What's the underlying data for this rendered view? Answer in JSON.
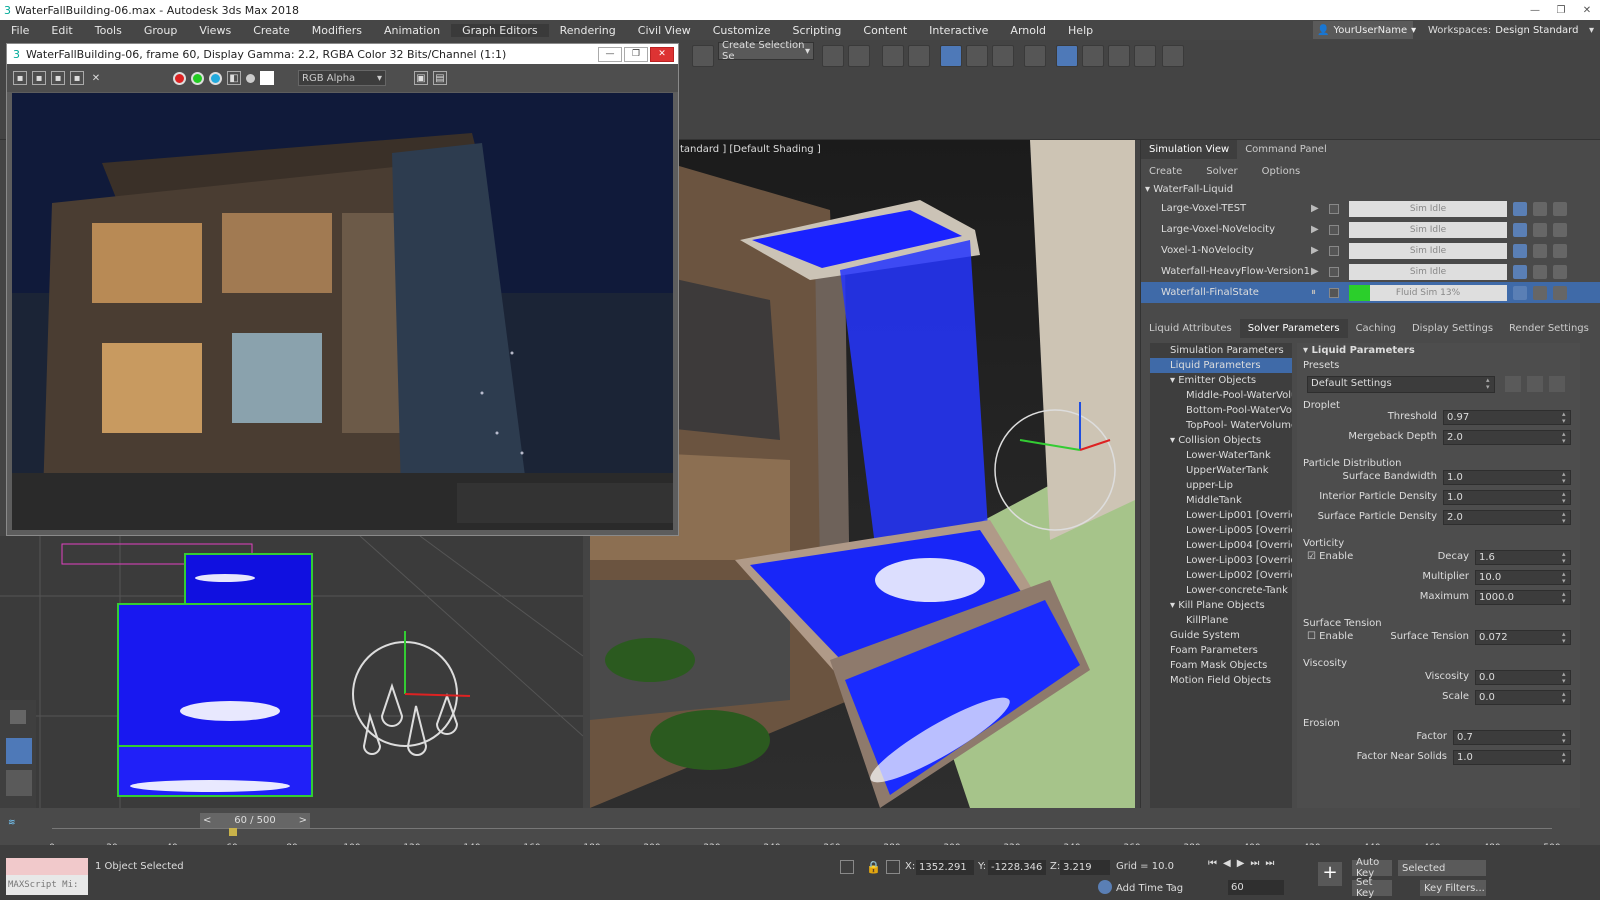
{
  "app": {
    "window_title": "WaterFallBuilding-06.max - Autodesk 3ds Max 2018",
    "user_name": "YourUserName",
    "workspaces_label": "Workspaces:",
    "workspace_value": "Design Standard"
  },
  "menu": [
    "File",
    "Edit",
    "Tools",
    "Group",
    "Views",
    "Create",
    "Modifiers",
    "Animation",
    "Graph Editors",
    "Rendering",
    "Civil View",
    "Customize",
    "Scripting",
    "Content",
    "Interactive",
    "Arnold",
    "Help"
  ],
  "toolbar": {
    "selection_set": "Create Selection Se"
  },
  "frame_buffer": {
    "title": "WaterFallBuilding-06, frame 60, Display Gamma: 2.2, RGBA Color 32 Bits/Channel (1:1)",
    "channel": "RGB Alpha"
  },
  "viewport": {
    "label": "tandard ] [Default Shading ]"
  },
  "sim_panel": {
    "tabs": [
      "Simulation View",
      "Command Panel"
    ],
    "subtabs": [
      "Create",
      "Solver",
      "Options"
    ],
    "group": "WaterFall-Liquid",
    "sims": [
      {
        "name": "Large-Voxel-TEST",
        "status": "Sim Idle",
        "progress": 0
      },
      {
        "name": "Large-Voxel-NoVelocity",
        "status": "Sim Idle",
        "progress": 0
      },
      {
        "name": "Voxel-1-NoVelocity",
        "status": "Sim Idle",
        "progress": 0
      },
      {
        "name": "Waterfall-HeavyFlow-Version1",
        "status": "Sim Idle",
        "progress": 0
      },
      {
        "name": "Waterfall-FinalState",
        "status": "Fluid Sim 13%",
        "progress": 0.13
      }
    ],
    "param_tabs": [
      "Liquid Attributes",
      "Solver Parameters",
      "Caching",
      "Display Settings",
      "Render Settings"
    ]
  },
  "tree": [
    {
      "label": "Simulation Parameters",
      "level": 1
    },
    {
      "label": "Liquid Parameters",
      "level": 1,
      "selected": true
    },
    {
      "label": "▾ Emitter Objects",
      "level": 0
    },
    {
      "label": "Middle-Pool-WaterVolu...",
      "level": 2
    },
    {
      "label": "Bottom-Pool-WaterVolu...",
      "level": 2
    },
    {
      "label": "TopPool- WaterVolume ...",
      "level": 2
    },
    {
      "label": "▾ Collision Objects",
      "level": 0
    },
    {
      "label": "Lower-WaterTank",
      "level": 2
    },
    {
      "label": "UpperWaterTank",
      "level": 2
    },
    {
      "label": "upper-Lip",
      "level": 2
    },
    {
      "label": "MiddleTank",
      "level": 2
    },
    {
      "label": "Lower-Lip001 [Override...",
      "level": 2
    },
    {
      "label": "Lower-Lip005 [Override...",
      "level": 2
    },
    {
      "label": "Lower-Lip004 [Override...",
      "level": 2
    },
    {
      "label": "Lower-Lip003 [Override...",
      "level": 2
    },
    {
      "label": "Lower-Lip002 [Override...",
      "level": 2
    },
    {
      "label": "Lower-concrete-Tank",
      "level": 2
    },
    {
      "label": "▾ Kill Plane Objects",
      "level": 0
    },
    {
      "label": "KillPlane",
      "level": 2
    },
    {
      "label": "Guide System",
      "level": 1
    },
    {
      "label": "Foam Parameters",
      "level": 1
    },
    {
      "label": "Foam Mask Objects",
      "level": 1
    },
    {
      "label": "Motion Field Objects",
      "level": 1
    }
  ],
  "params": {
    "header": "Liquid Parameters",
    "presets_label": "Presets",
    "preset_value": "Default Settings",
    "droplet": "Droplet",
    "threshold_label": "Threshold",
    "threshold": "0.97",
    "mergeback_label": "Mergeback Depth",
    "mergeback": "2.0",
    "particle_dist": "Particle Distribution",
    "surf_bw_label": "Surface Bandwidth",
    "surf_bw": "1.0",
    "int_dens_label": "Interior Particle Density",
    "int_dens": "1.0",
    "surf_dens_label": "Surface Particle Density",
    "surf_dens": "2.0",
    "vorticity": "Vorticity",
    "enable": "Enable",
    "decay_label": "Decay",
    "decay": "1.6",
    "mult_label": "Multiplier",
    "mult": "10.0",
    "max_label": "Maximum",
    "max": "1000.0",
    "surf_tension": "Surface Tension",
    "st_label": "Surface Tension",
    "st": "0.072",
    "viscosity": "Viscosity",
    "visc_label": "Viscosity",
    "visc": "0.0",
    "scale_label": "Scale",
    "scale": "0.0",
    "erosion": "Erosion",
    "factor_label": "Factor",
    "factor": "0.7",
    "fns_label": "Factor Near Solids",
    "fns": "1.0"
  },
  "timeline": {
    "frame": "60 / 500",
    "ticks": [
      "0",
      "20",
      "40",
      "60",
      "80",
      "100",
      "120",
      "140",
      "160",
      "180",
      "200",
      "220",
      "240",
      "260",
      "280",
      "300",
      "320",
      "340",
      "360",
      "380",
      "400",
      "420",
      "440",
      "460",
      "480",
      "500"
    ]
  },
  "status": {
    "selected": "1 Object Selected",
    "maxscript": "MAXScript Mi:",
    "x_label": "X:",
    "x": "1352.291",
    "y_label": "Y:",
    "y": "-1228.346",
    "z_label": "Z:",
    "z": "3.219",
    "grid": "Grid = 10.0",
    "add_time_tag": "Add Time Tag",
    "auto_key": "Auto Key",
    "selected_dd": "Selected",
    "set_key": "Set Key",
    "key_filters": "Key Filters...",
    "frame_field": "60"
  }
}
